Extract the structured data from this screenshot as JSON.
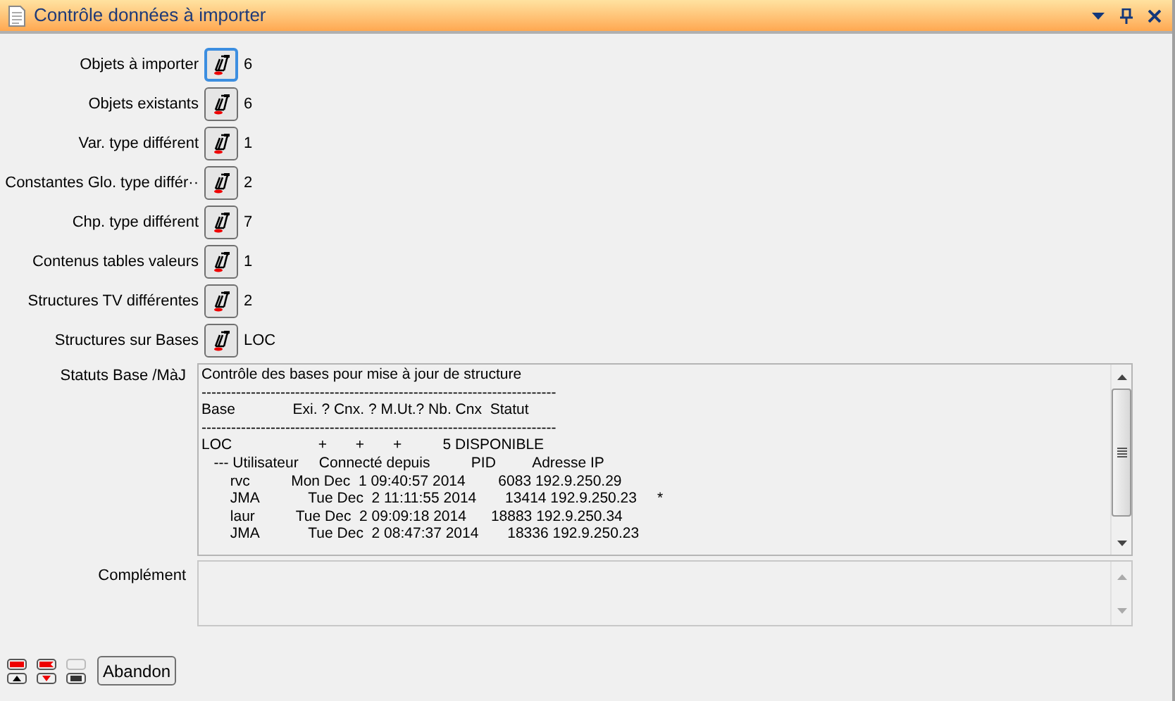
{
  "window": {
    "title": "Contrôle données à importer"
  },
  "rows": [
    {
      "label": "Objets à importer",
      "value": "6",
      "focused": true
    },
    {
      "label": "Objets existants",
      "value": "6",
      "focused": false
    },
    {
      "label": "Var. type différent",
      "value": "1",
      "focused": false
    },
    {
      "label": "Constantes Glo. type différ··",
      "value": "2",
      "focused": false
    },
    {
      "label": "Chp. type différent",
      "value": "7",
      "focused": false
    },
    {
      "label": "Contenus tables valeurs",
      "value": "1",
      "focused": false
    },
    {
      "label": "Structures TV différentes",
      "value": "2",
      "focused": false
    },
    {
      "label": "Structures sur Bases",
      "value": "LOC",
      "focused": false
    }
  ],
  "status": {
    "label": "Statuts Base /MàJ",
    "lines": [
      "Contrôle des bases pour mise à jour de structure",
      "------------------------------------------------------------------------",
      "Base              Exi. ? Cnx. ? M.Ut.? Nb. Cnx  Statut",
      "------------------------------------------------------------------------",
      "LOC                     +       +       +          5 DISPONIBLE",
      "   --- Utilisateur     Connecté depuis          PID         Adresse IP",
      "       rvc          Mon Dec  1 09:40:57 2014        6083 192.9.250.29",
      "       JMA            Tue Dec  2 11:11:55 2014       13414 192.9.250.23     *",
      "       laur          Tue Dec  2 09:09:18 2014      18883 192.9.250.34",
      "       JMA            Tue Dec  2 08:47:37 2014       18336 192.9.250.23"
    ]
  },
  "complement": {
    "label": "Complément"
  },
  "buttons": [
    "Abandon"
  ]
}
